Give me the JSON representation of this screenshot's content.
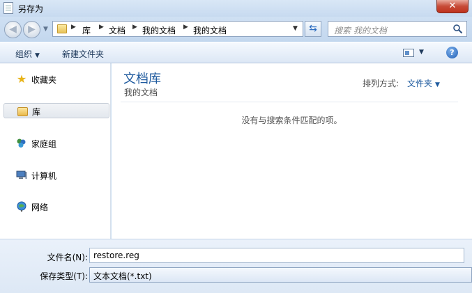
{
  "window": {
    "title": "另存为",
    "close_glyph": "✕"
  },
  "address": {
    "breadcrumbs": [
      "库",
      "文档",
      "我的文档",
      "我的文档"
    ],
    "search_placeholder": "搜索 我的文档"
  },
  "toolbar": {
    "organize_label": "组织",
    "new_folder_label": "新建文件夹",
    "help_glyph": "?"
  },
  "navigation": {
    "items": [
      {
        "label": "收藏夹",
        "icon": "favorites-star-icon"
      },
      {
        "label": "库",
        "icon": "library-folder-icon",
        "selected": true
      },
      {
        "label": "家庭组",
        "icon": "homegroup-icon"
      },
      {
        "label": "计算机",
        "icon": "computer-icon"
      },
      {
        "label": "网络",
        "icon": "network-icon"
      }
    ]
  },
  "content": {
    "library_title": "文档库",
    "library_subtitle": "我的文档",
    "arrange_label": "排列方式:",
    "arrange_value": "文件夹",
    "empty_message": "没有与搜索条件匹配的项。"
  },
  "fields": {
    "filename_label": "文件名(N):",
    "filename_value": "restore.reg",
    "filetype_label": "保存类型(T):",
    "filetype_value": "文本文档(*.txt)"
  },
  "colors": {
    "accent": "#1e5a9e",
    "close": "#c74b37"
  }
}
